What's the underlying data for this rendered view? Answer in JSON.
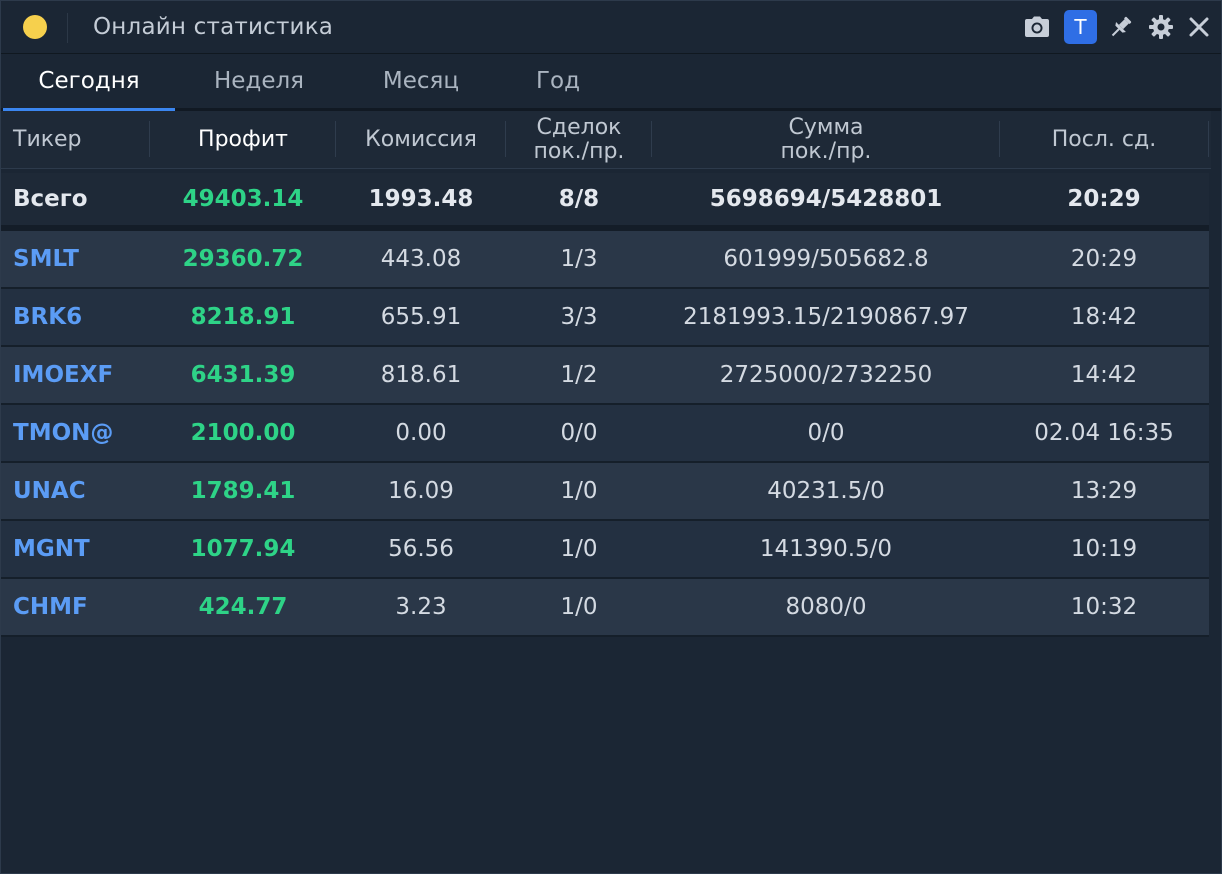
{
  "window": {
    "title": "Онлайн статистика",
    "colors": {
      "status_dot": "#f6d04d",
      "accent": "#2f6ee5",
      "profit": "#2ed387",
      "ticker": "#5b9cf5"
    }
  },
  "toolbar": {
    "camera_icon": "camera-icon",
    "t_label": "T",
    "pin_icon": "pin-icon",
    "settings_icon": "gear-icon",
    "close_icon": "close-icon"
  },
  "tabs": [
    {
      "label": "Сегодня",
      "active": true
    },
    {
      "label": "Неделя",
      "active": false
    },
    {
      "label": "Месяц",
      "active": false
    },
    {
      "label": "Год",
      "active": false
    }
  ],
  "table": {
    "headers": {
      "ticker": "Тикер",
      "profit": "Профит",
      "commission": "Комиссия",
      "deals_line1": "Сделок",
      "deals_line2": "пок./пр.",
      "sum_line1": "Сумма",
      "sum_line2": "пок./пр.",
      "last": "Посл. сд."
    },
    "total": {
      "ticker": "Всего",
      "profit": "49403.14",
      "commission": "1993.48",
      "deals": "8/8",
      "sum": "5698694/5428801",
      "last": "20:29"
    },
    "rows": [
      {
        "ticker": "SMLT",
        "profit": "29360.72",
        "commission": "443.08",
        "deals": "1/3",
        "sum": "601999/505682.8",
        "last": "20:29"
      },
      {
        "ticker": "BRK6",
        "profit": "8218.91",
        "commission": "655.91",
        "deals": "3/3",
        "sum": "2181993.15/2190867.97",
        "last": "18:42"
      },
      {
        "ticker": "IMOEXF",
        "profit": "6431.39",
        "commission": "818.61",
        "deals": "1/2",
        "sum": "2725000/2732250",
        "last": "14:42"
      },
      {
        "ticker": "TMON@",
        "profit": "2100.00",
        "commission": "0.00",
        "deals": "0/0",
        "sum": "0/0",
        "last": "02.04 16:35"
      },
      {
        "ticker": "UNAC",
        "profit": "1789.41",
        "commission": "16.09",
        "deals": "1/0",
        "sum": "40231.5/0",
        "last": "13:29"
      },
      {
        "ticker": "MGNT",
        "profit": "1077.94",
        "commission": "56.56",
        "deals": "1/0",
        "sum": "141390.5/0",
        "last": "10:19"
      },
      {
        "ticker": "CHMF",
        "profit": "424.77",
        "commission": "3.23",
        "deals": "1/0",
        "sum": "8080/0",
        "last": "10:32"
      }
    ]
  }
}
